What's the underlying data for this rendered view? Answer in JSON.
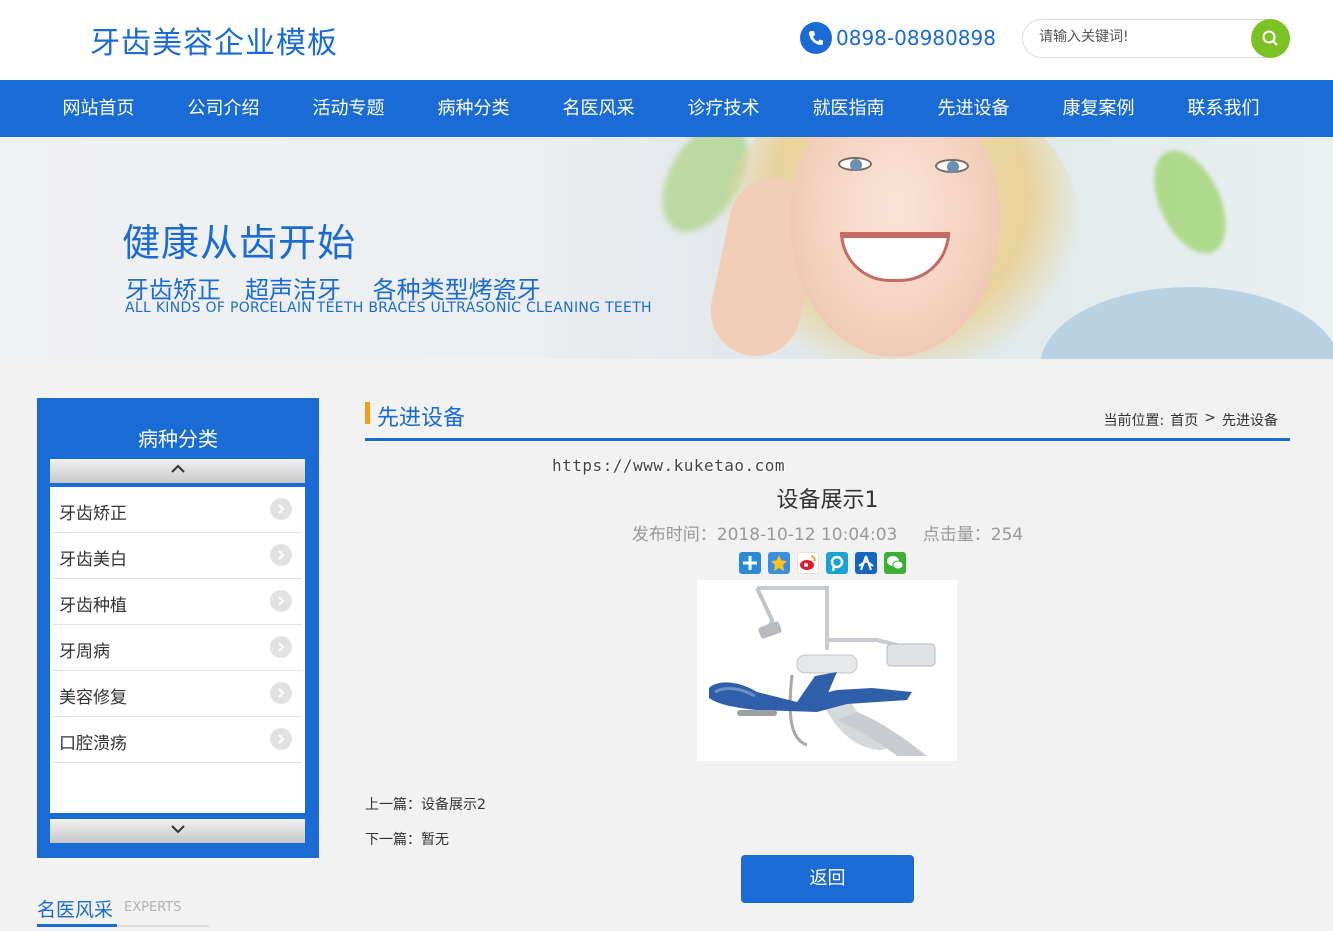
{
  "header": {
    "logo": "牙齿美容企业模板",
    "phone": "0898-08980898",
    "search_placeholder": "请输入关键词!"
  },
  "nav": [
    "网站首页",
    "公司介绍",
    "活动专题",
    "病种分类",
    "名医风采",
    "诊疗技术",
    "就医指南",
    "先进设备",
    "康复案例",
    "联系我们"
  ],
  "banner": {
    "title": "健康从齿开始",
    "subtitle": "牙齿矫正　超声洁牙　 各种类型烤瓷牙",
    "english": "ALL KINDS OF PORCELAIN TEETH BRACES ULTRASONIC CLEANING TEETH"
  },
  "sidebar": {
    "title": "病种分类",
    "items": [
      "牙齿矫正",
      "牙齿美白",
      "牙齿种植",
      "牙周病",
      "美容修复",
      "口腔溃疡"
    ]
  },
  "experts": {
    "title": "名医风采",
    "en": "EXPERTS"
  },
  "main": {
    "heading": "先进设备",
    "crumb_label": "当前位置:",
    "crumb_home": "首页",
    "crumb_sep": ">",
    "crumb_current": "先进设备",
    "watermark": "https://www.kuketao.com",
    "article_title": "设备展示1",
    "publish_time": "发布时间：2018-10-12 10:04:03",
    "views": "点击量：254",
    "prev": "上一篇：设备展示2",
    "next": "下一篇：暂无",
    "back": "返回"
  },
  "colors": {
    "primary": "#1a6bd6",
    "accent": "#f59c1a",
    "search_button": "#7cc223"
  },
  "icons": [
    "phone-icon",
    "search-icon",
    "chevron-up-icon",
    "chevron-down-icon",
    "chevron-right-icon",
    "share-plus-icon",
    "qzone-icon",
    "weibo-icon",
    "tencent-icon",
    "renren-icon",
    "wechat-icon"
  ]
}
